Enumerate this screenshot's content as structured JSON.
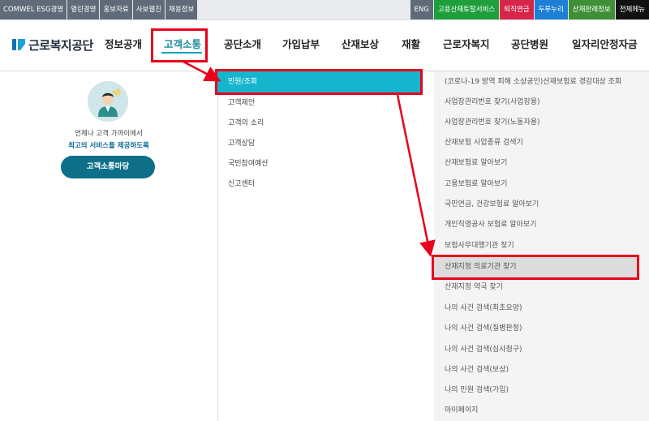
{
  "topbar": {
    "left_links": [
      "COMWEL ESG경영",
      "열린경영",
      "홍보자료",
      "사보웹진",
      "채용정보"
    ],
    "right_links": [
      {
        "label": "ENG",
        "color": "#5f6b78"
      },
      {
        "label": "고용산재토탈서비스",
        "color": "#1e9f3c"
      },
      {
        "label": "퇴직연금",
        "color": "#d7254a"
      },
      {
        "label": "두루누리",
        "color": "#1d7fd6"
      },
      {
        "label": "산재판례정보",
        "color": "#3f8f36"
      },
      {
        "label": "전체메뉴",
        "color": "#111111"
      }
    ]
  },
  "logo": {
    "text": "근로복지공단"
  },
  "nav": {
    "items": [
      "정보공개",
      "고객소통",
      "공단소개",
      "가입납부",
      "산재보상",
      "재활",
      "근로자복지",
      "공단병원",
      "일자리안정자금"
    ],
    "active": "고객소통"
  },
  "left_panel": {
    "line1": "언제나 고객 가까이에서",
    "line2": "최고의 서비스를 제공하도록",
    "button": "고객소통마당"
  },
  "sub_menu": {
    "active": "민원/조회",
    "items": [
      "고객제안",
      "고객의 소리",
      "고객상담",
      "국민참여예산",
      "신고센터"
    ]
  },
  "detail_menu": {
    "items": [
      "(코로나-19 방역 피해 소상공인)산재보험료 경감대상 조회",
      "사업장관리번호 찾기(사업장용)",
      "사업장관리번호 찾기(노동자용)",
      "산재보험 사업종류 검색기",
      "산재보험료 알아보기",
      "고용보험료 알아보기",
      "국민연금, 건강보험료 알아보기",
      "개인직영공사 보험료 알아보기",
      "보험사무대행기관 찾기",
      "산재지정 의료기관 찾기",
      "산재지정 약국 찾기",
      "나의 사건 검색(최초요양)",
      "나의 사건 검색(질병판정)",
      "나의 사건 검색(심사청구)",
      "나의 사건 검색(보상)",
      "나의 민원 검색(가입)",
      "마이페이지"
    ],
    "highlighted": "산재지정 의료기관 찾기"
  },
  "colors": {
    "accent": "#15b6cd",
    "highlight_border": "#e8001c",
    "button": "#0e6f88"
  }
}
